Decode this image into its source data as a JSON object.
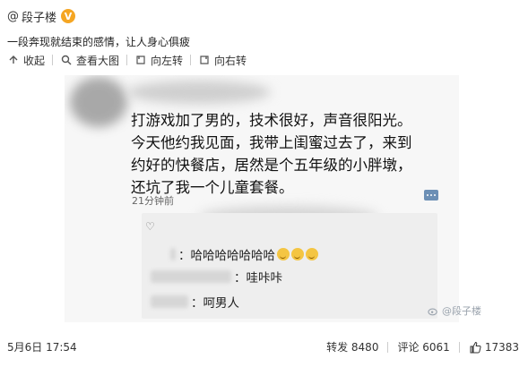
{
  "header": {
    "at": "@",
    "username": "段子楼",
    "badge": "V"
  },
  "post": {
    "text": "一段奔现就结束的感情，让人身心俱疲"
  },
  "toolbar": {
    "collapse": "收起",
    "view_large": "查看大图",
    "rotate_left": "向左转",
    "rotate_right": "向右转"
  },
  "screenshot": {
    "tweet_line1": "打游戏加了男的，技术很好，声音很阳光。",
    "tweet_line2": "今天他约我见面，我带上闺蜜过去了，来到",
    "tweet_line3": "约好的快餐店，居然是个五年级的小胖墩，",
    "tweet_line4": "还坑了我一个儿童套餐。",
    "time": "21分钟前",
    "comments": [
      {
        "text": "：哈哈哈哈哈哈哈"
      },
      {
        "text": "：哇咔咔"
      },
      {
        "text": "：呵男人"
      }
    ],
    "watermark": "@段子楼"
  },
  "footer": {
    "date": "5月6日 17:54",
    "repost": "转发 8480",
    "comment": "评论 6061",
    "likes": "17383"
  },
  "icons": {
    "collapse": "arrow-up-icon",
    "view_large": "magnifier-icon",
    "rotate_left": "rotate-left-icon",
    "rotate_right": "rotate-right-icon",
    "like": "thumbs-up-icon",
    "weibo": "weibo-logo-icon"
  },
  "colors": {
    "badge": "#f5a623",
    "watermark": "#9aa3ad",
    "more_button": "#6c8fb5"
  }
}
